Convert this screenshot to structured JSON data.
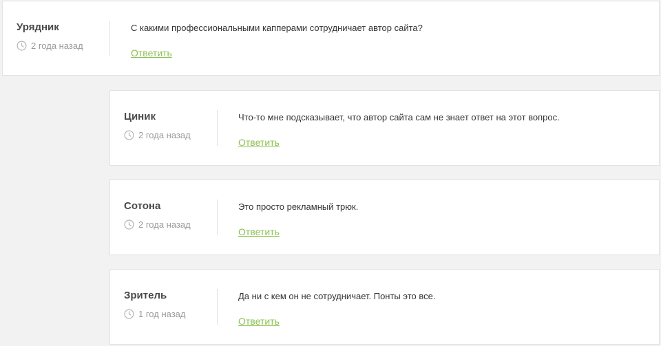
{
  "accent_color": "#8cc152",
  "comments": [
    {
      "author": "Урядник",
      "time": "2 года назад",
      "text": "С какими профессиональными капперами сотрудничает автор сайта?",
      "reply_label": "Ответить"
    },
    {
      "author": "Циник",
      "time": "2 года назад",
      "text": "Что-то мне подсказывает, что автор сайта сам не знает ответ на этот вопрос.",
      "reply_label": "Ответить"
    },
    {
      "author": "Сотона",
      "time": "2 года назад",
      "text": "Это просто рекламный трюк.",
      "reply_label": "Ответить"
    },
    {
      "author": "Зритель",
      "time": "1 год назад",
      "text": "Да ни с кем он не сотрудничает. Понты это все.",
      "reply_label": "Ответить"
    }
  ]
}
